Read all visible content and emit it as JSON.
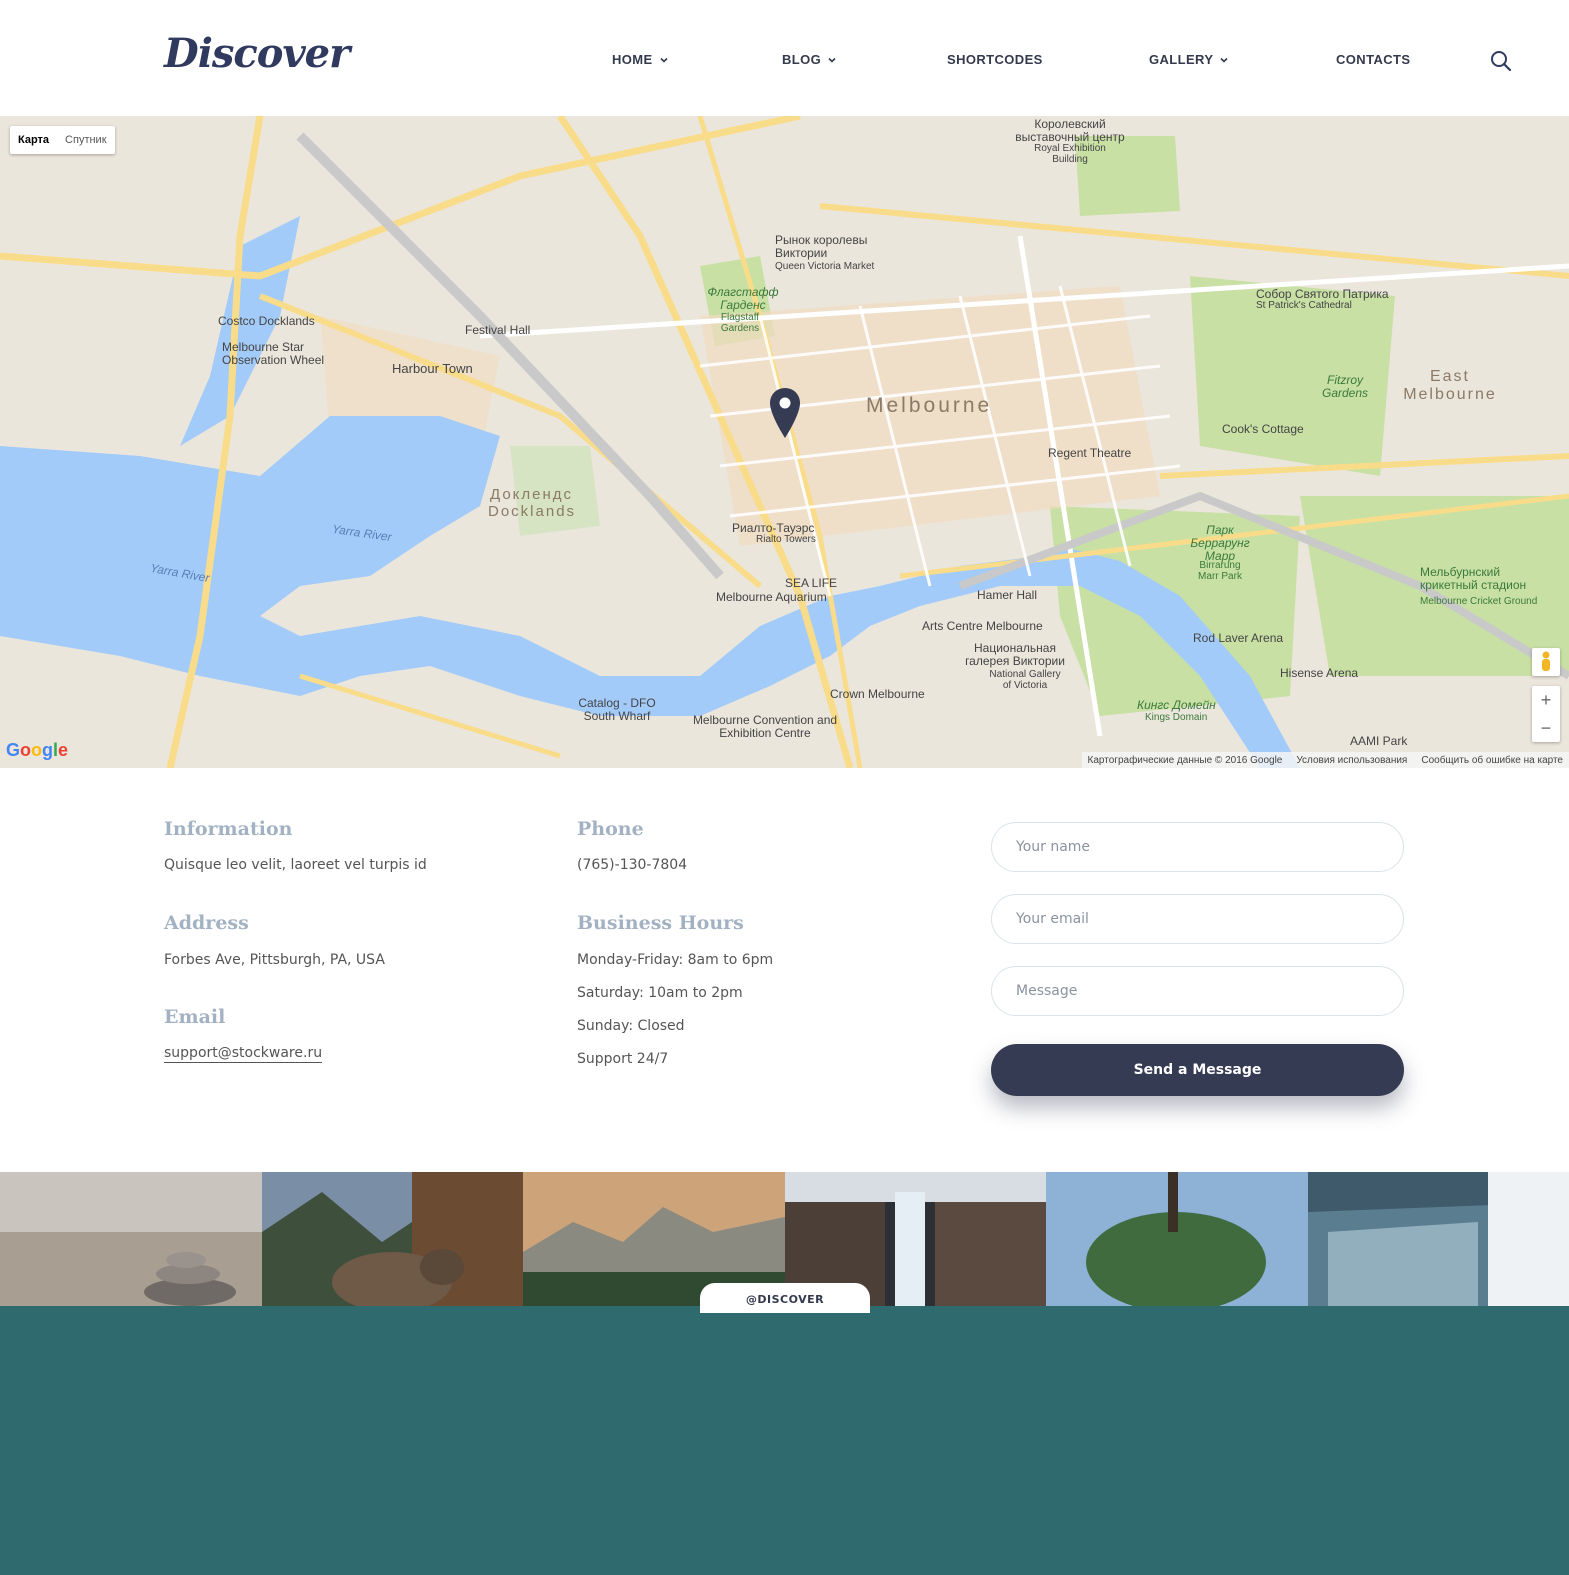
{
  "brand": {
    "logo_text": "Discover"
  },
  "nav": {
    "items": [
      {
        "label": "HOME",
        "has_dropdown": true
      },
      {
        "label": "BLOG",
        "has_dropdown": true
      },
      {
        "label": "SHORTCODES",
        "has_dropdown": false
      },
      {
        "label": "GALLERY",
        "has_dropdown": true
      },
      {
        "label": "CONTACTS",
        "has_dropdown": false,
        "active": true
      }
    ],
    "search_icon": "search-icon"
  },
  "map": {
    "type_buttons": {
      "map": "Карта",
      "satellite": "Спутник"
    },
    "labels": {
      "melbourne": "Melbourne",
      "east_melbourne": "East Melbourne",
      "docklands_ru": "Доклендс",
      "docklands": "Docklands",
      "yarra_river": "Yarra River",
      "festival_hall": "Festival Hall",
      "harbour_town": "Harbour Town",
      "costco": "Costco Docklands",
      "star_wheel": "Melbourne Star Observation Wheel",
      "queen_vic_ru": "Рынок королевы Виктории",
      "queen_vic": "Queen Victoria Market",
      "regent_theatre": "Regent Theatre",
      "cooks_cottage": "Cook's Cottage",
      "st_patricks_ru": "Собор Святого Патрика",
      "st_patricks": "St Patrick's Cathedral",
      "rialto_ru": "Риалто-Тауэрс",
      "rialto": "Rialto Towers",
      "sea_life": "SEA LIFE",
      "aquarium": "Melbourne Aquarium",
      "hamer_hall": "Hamer Hall",
      "arts_centre": "Arts Centre Melbourne",
      "ngv_ru": "Национальная галерея Виктории",
      "ngv": "National Gallery of Victoria",
      "crown": "Crown Melbourne",
      "convention": "Melbourne Convention and Exhibition Centre",
      "catalog": "Catalog - DFO South Wharf",
      "rod_laver": "Rod Laver Arena",
      "hisense": "Hisense Arena",
      "aami": "AAMI Park",
      "mcg_ru": "Мельбурнский крикетный стадион",
      "mcg": "Melbourne Cricket Ground",
      "royal_exhibition_ru": "Королевский выставочный центр",
      "royal_exhibition": "Royal Exhibition Building",
      "fitzroy": "Fitzroy Gardens",
      "kings_domain_ru": "Кингс Домейн",
      "kings_domain": "Kings Domain",
      "flagstaff_ru": "Флагстафф Гарденс",
      "flagstaff": "Flagstaff Gardens",
      "birrarung_ru": "Парк Беррарунг Марр",
      "birrarung": "Birrarung Marr Park"
    },
    "google_logo": "Google",
    "footer": {
      "data": "Картографические данные © 2016 Google",
      "terms": "Условия использования",
      "report": "Сообщить об ошибке на карте"
    }
  },
  "contact": {
    "information": {
      "title": "Information",
      "text": "Quisque leo velit, laoreet vel turpis id"
    },
    "address": {
      "title": "Address",
      "text": "Forbes Ave, Pittsburgh, PA, USA"
    },
    "email": {
      "title": "Email",
      "text": "support@stockware.ru"
    },
    "phone": {
      "title": "Phone",
      "text": "(765)-130-7804"
    },
    "hours": {
      "title": "Business Hours",
      "lines": [
        "Monday-Friday: 8am to 6pm",
        "Saturday: 10am to 2pm",
        "Sunday: Closed",
        "Support 24/7"
      ]
    },
    "form": {
      "name_placeholder": "Your name",
      "email_placeholder": "Your email",
      "message_placeholder": "Message",
      "submit_label": "Send a Message"
    }
  },
  "gallery": {
    "handle": "@DISCOVER",
    "tiles": [
      "stone-stack-photo",
      "deer-photo",
      "mountain-forest-photo",
      "waterfall-photo",
      "tree-reflection-photo",
      "waterfall-cascade-photo"
    ]
  },
  "colors": {
    "brand_navy": "#2f3a5e",
    "button_dark": "#363b54",
    "heading_gray_blue": "#a3b2c2",
    "footer_teal": "#2e6a6e"
  }
}
